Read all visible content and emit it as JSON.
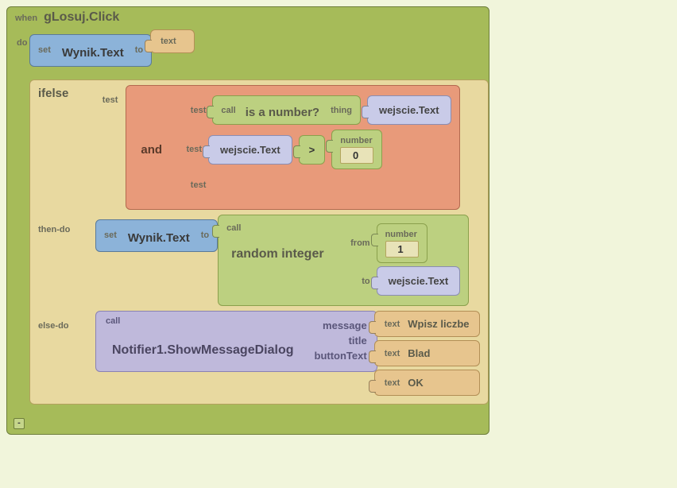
{
  "event": {
    "when_label": "when",
    "handler": "gLosuj.Click",
    "do_label": "do",
    "collapse_symbol": "-"
  },
  "set1": {
    "set_label": "set",
    "target": "Wynik.Text",
    "to_label": "to",
    "text_label": "text",
    "text_value": ""
  },
  "ifelse": {
    "keyword": "ifelse",
    "test_label": "test",
    "then_label": "then-do",
    "else_label": "else-do"
  },
  "and": {
    "keyword": "and",
    "slot_label": "test"
  },
  "isnumber": {
    "call_label": "call",
    "name": "is a number?",
    "arg_label": "thing",
    "arg_value": "wejscie.Text"
  },
  "compare": {
    "left": "wejscie.Text",
    "op": ">",
    "number_label": "number",
    "right": "0"
  },
  "set2": {
    "set_label": "set",
    "target": "Wynik.Text",
    "to_label": "to"
  },
  "random": {
    "call_label": "call",
    "name": "random integer",
    "from_label": "from",
    "to_label": "to",
    "from_number_label": "number",
    "from_value": "1",
    "to_value": "wejscie.Text"
  },
  "notifier": {
    "call_label": "call",
    "name": "Notifier1.ShowMessageDialog",
    "args": {
      "message_label": "message",
      "title_label": "title",
      "buttonText_label": "buttonText",
      "text_label": "text",
      "message": "Wpisz liczbe",
      "title": "Blad",
      "buttonText": "OK"
    }
  }
}
